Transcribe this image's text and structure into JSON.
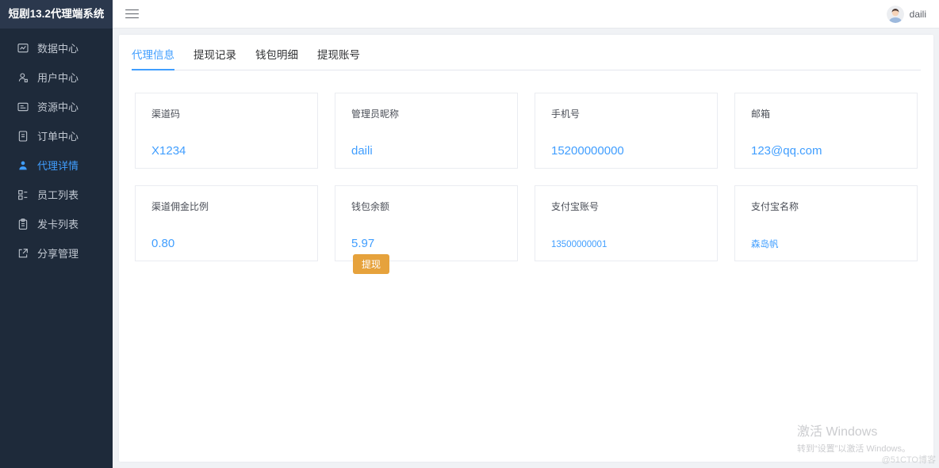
{
  "app": {
    "title": "短剧13.2代理端系统"
  },
  "header": {
    "username": "daili"
  },
  "sidebar": {
    "items": [
      {
        "label": "数据中心",
        "icon": "chart-icon",
        "active": false
      },
      {
        "label": "用户中心",
        "icon": "user-icon",
        "active": false
      },
      {
        "label": "资源中心",
        "icon": "resource-icon",
        "active": false
      },
      {
        "label": "订单中心",
        "icon": "order-icon",
        "active": false
      },
      {
        "label": "代理详情",
        "icon": "agent-icon",
        "active": true
      },
      {
        "label": "员工列表",
        "icon": "staff-icon",
        "active": false
      },
      {
        "label": "发卡列表",
        "icon": "card-icon",
        "active": false
      },
      {
        "label": "分享管理",
        "icon": "share-icon",
        "active": false
      }
    ]
  },
  "tabs": {
    "items": [
      {
        "label": "代理信息",
        "active": true
      },
      {
        "label": "提现记录",
        "active": false
      },
      {
        "label": "钱包明细",
        "active": false
      },
      {
        "label": "提现账号",
        "active": false
      }
    ]
  },
  "cards": [
    {
      "label": "渠道码",
      "value": "X1234"
    },
    {
      "label": "管理员昵称",
      "value": "daili"
    },
    {
      "label": "手机号",
      "value": "15200000000"
    },
    {
      "label": "邮箱",
      "value": "123@qq.com"
    },
    {
      "label": "渠道佣金比例",
      "value": "0.80"
    },
    {
      "label": "钱包余额",
      "value": "5.97",
      "button": "提现"
    },
    {
      "label": "支付宝账号",
      "value": "13500000001",
      "small": true
    },
    {
      "label": "支付宝名称",
      "value": "森岛帆",
      "small": true
    }
  ],
  "watermark": {
    "line1": "激活 Windows",
    "line2": "转到“设置”以激活 Windows。",
    "badge": "@51CTO博客"
  },
  "colors": {
    "primary": "#409eff",
    "warning": "#e6a23c",
    "sidebar_bg": "#1e2a3a",
    "logo_bg": "#2b384d",
    "page_bg": "#f0f2f5"
  }
}
